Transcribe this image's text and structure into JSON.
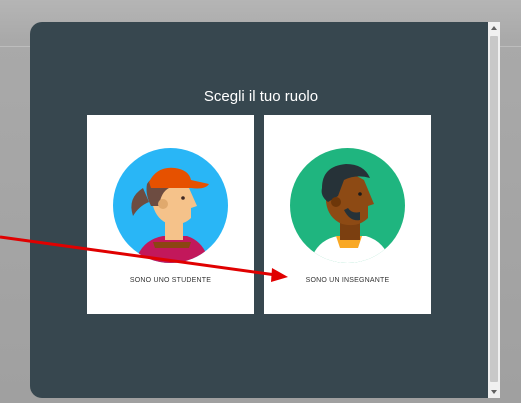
{
  "dialog": {
    "title": "Scegli il tuo ruolo",
    "cards": [
      {
        "label": "SONO UNO STUDENTE",
        "avatar": "student-avatar-icon"
      },
      {
        "label": "SONO UN INSEGNANTE",
        "avatar": "teacher-avatar-icon"
      }
    ]
  },
  "colors": {
    "dialog_bg": "#37474f",
    "student_circle": "#29b6f6",
    "teacher_circle": "#1fb57f",
    "annotation_arrow": "#e00000"
  },
  "scrollbar": {
    "icons": [
      "scroll-up-arrow-icon",
      "scroll-down-arrow-icon"
    ]
  }
}
